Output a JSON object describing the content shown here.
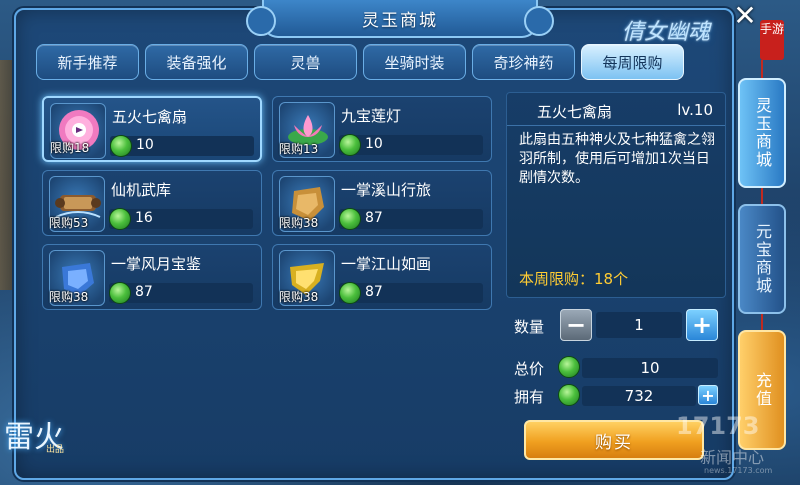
{
  "window": {
    "title": "灵玉商城"
  },
  "logo": {
    "text": "倩女幽魂",
    "mobile_tag": "手游"
  },
  "tabs": [
    {
      "label": "新手推荐",
      "active": false
    },
    {
      "label": "装备强化",
      "active": false
    },
    {
      "label": "灵兽",
      "active": false
    },
    {
      "label": "坐骑时装",
      "active": false
    },
    {
      "label": "奇珍神药",
      "active": false
    },
    {
      "label": "每周限购",
      "active": true
    }
  ],
  "items": [
    {
      "name": "五火七禽扇",
      "limit": "限购18",
      "price": "10",
      "icon": "fan-icon",
      "selected": true
    },
    {
      "name": "九宝莲灯",
      "limit": "限购13",
      "price": "10",
      "icon": "lotus-lamp-icon",
      "selected": false
    },
    {
      "name": "仙机武库",
      "limit": "限购53",
      "price": "16",
      "icon": "scroll-icon",
      "selected": false
    },
    {
      "name": "一掌溪山行旅",
      "limit": "限购38",
      "price": "87",
      "icon": "painting-fragment-icon",
      "selected": false
    },
    {
      "name": "一掌风月宝鉴",
      "limit": "限购38",
      "price": "87",
      "icon": "blue-fragment-icon",
      "selected": false
    },
    {
      "name": "一掌江山如画",
      "limit": "限购38",
      "price": "87",
      "icon": "gold-fragment-icon",
      "selected": false
    }
  ],
  "detail": {
    "name": "五火七禽扇",
    "level": "lv.10",
    "description": "此扇由五种神火及七种猛禽之翎羽所制，使用后可增加1次当日剧情次数。",
    "weekly_limit": "本周限购：18个"
  },
  "purchase": {
    "qty_label": "数量",
    "qty_value": "1",
    "minus": "−",
    "plus": "+",
    "total_label": "总价",
    "total_value": "10",
    "own_label": "拥有",
    "own_value": "732",
    "buy_label": "购买"
  },
  "side_tabs": [
    {
      "label": "灵玉商城",
      "active": true
    },
    {
      "label": "元宝商城",
      "active": false
    },
    {
      "label": "充值",
      "active": false
    }
  ],
  "close": "✕",
  "bottom_logo": {
    "text": "雷火",
    "sub": "出品"
  },
  "watermark": {
    "text": "17173",
    "sub": "新闻中心",
    "url": "news.17173.com"
  },
  "colors": {
    "accent_blue": "#5fa8e6",
    "limit_text": "#ffcc33",
    "buy_orange": "#f0a020",
    "jade_green": "#4bbf3c"
  }
}
